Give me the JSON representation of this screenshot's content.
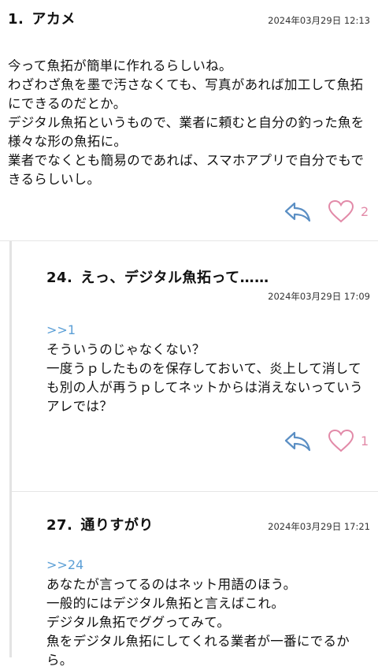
{
  "posts": [
    {
      "number": "1.",
      "name": "アカメ",
      "date": "2024年03月29日 12:13",
      "quote": "",
      "body": "今って魚拓が簡単に作れるらしいね。\nわざわざ魚を墨で汚さなくても、写真があれば加工して魚拓にできるのだとか。\nデジタル魚拓というもので、業者に頼むと自分の釣った魚を様々な形の魚拓に。\n業者でなくとも簡易のであれば、スマホアプリで自分でもできるらしいし。",
      "likes": "2"
    },
    {
      "number": "24.",
      "name": "えっ、デジタル魚拓って……",
      "date": "2024年03月29日 17:09",
      "quote": ">>1",
      "body": "そういうのじゃなくない？\n一度うｐしたものを保存しておいて、炎上して消しても別の人が再うｐしてネットからは消えないっていうアレでは？",
      "likes": "1"
    },
    {
      "number": "27.",
      "name": "通りすがり",
      "date": "2024年03月29日 17:21",
      "quote": ">>24",
      "body": "あなたが言ってるのはネット用語のほう。\n一般的にはデジタル魚拓と言えばこれ。\nデジタル魚拓でググってみて。\n魚をデジタル魚拓にしてくれる業者が一番にでるから。",
      "likes": ""
    }
  ],
  "colors": {
    "reply_icon": "#5b8fc4",
    "heart_icon": "#e28aa8",
    "quote_link": "#5b9fd6"
  },
  "icons": [
    "reply-arrow-icon",
    "heart-icon"
  ]
}
